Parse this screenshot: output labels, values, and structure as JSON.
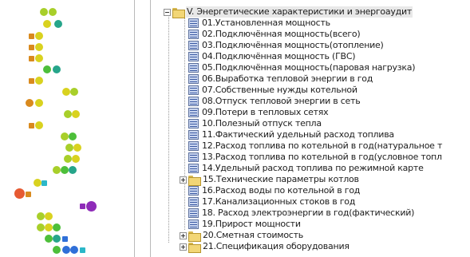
{
  "tree": {
    "root": {
      "label": "V. Энергетические характеристики и энергоаудит",
      "expanded": true,
      "icon": "folder-open-icon"
    },
    "children": [
      {
        "label": "01.Установленная мощность",
        "icon": "report-icon"
      },
      {
        "label": "02.Подключённая мощность(всего)",
        "icon": "report-icon"
      },
      {
        "label": "03.Подключённая мощность(отопление)",
        "icon": "report-icon"
      },
      {
        "label": "04.Подключённая мощность (ГВС)",
        "icon": "report-icon"
      },
      {
        "label": "05.Подключённая мощность(паровая нагрузка)",
        "icon": "report-icon"
      },
      {
        "label": "06.Выработка тепловой энергии в год",
        "icon": "report-icon"
      },
      {
        "label": "07.Собственные нужды котельной",
        "icon": "report-icon"
      },
      {
        "label": "08.Отпуск тепловой энергии в сеть",
        "icon": "report-icon"
      },
      {
        "label": "09.Потери в тепловых сетях",
        "icon": "report-icon"
      },
      {
        "label": "10.Полезный отпуск тепла",
        "icon": "report-icon"
      },
      {
        "label": "11.Фактический удельный расход топлива",
        "icon": "report-icon"
      },
      {
        "label": "12.Расход топлива по котельной в год(натуральное т",
        "icon": "report-icon"
      },
      {
        "label": "13.Расход топлива по котельной в год(условное топл",
        "icon": "report-icon"
      },
      {
        "label": "14.Удельный расход топлива по режимной карте",
        "icon": "report-icon"
      },
      {
        "label": "15.Технические параметры котлов",
        "icon": "folder-icon",
        "collapsed": true
      },
      {
        "label": "16.Расход воды по котельной в год",
        "icon": "report-icon"
      },
      {
        "label": "17.Канализационных стоков в год",
        "icon": "report-icon"
      },
      {
        "label": "18. Расход электроэнергии в год(фактический)",
        "icon": "report-icon"
      },
      {
        "label": "19.Прирост мощности",
        "icon": "report-icon"
      }
    ],
    "siblings": [
      {
        "label": "20.Сметная стоимость",
        "icon": "folder-icon",
        "collapsed": true
      },
      {
        "label": "21.Спецификация оборудования",
        "icon": "folder-icon",
        "collapsed": true
      }
    ]
  },
  "colors": {
    "yellow": "#d9d21f",
    "yellow_green": "#a8cf2a",
    "green": "#4dbf3a",
    "teal": "#26a58a",
    "orange": "#d98a1e",
    "red": "#e65a32",
    "purple": "#8e2bb8",
    "blue": "#2f6fd8",
    "cyan": "#2bb7c8"
  }
}
